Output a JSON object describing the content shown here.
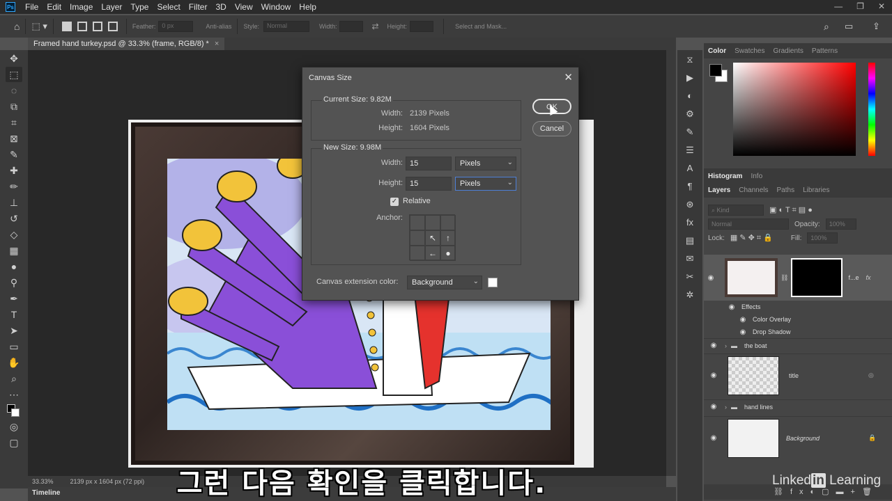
{
  "menubar": {
    "logo": "Ps",
    "items": [
      "File",
      "Edit",
      "Image",
      "Layer",
      "Type",
      "Select",
      "Filter",
      "3D",
      "View",
      "Window",
      "Help"
    ]
  },
  "options": {
    "feather_label": "Feather:",
    "feather_value": "0 px",
    "antialias": "Anti-alias",
    "style_label": "Style:",
    "style_value": "Normal",
    "width_label": "Width:",
    "height_label": "Height:",
    "select_mask": "Select and Mask..."
  },
  "document": {
    "tab_title": "Framed hand turkey.psd @ 33.3% (frame, RGB/8) *"
  },
  "dialog": {
    "title": "Canvas Size",
    "current_size_label": "Current Size: 9.82M",
    "current_width_label": "Width:",
    "current_width_value": "2139 Pixels",
    "current_height_label": "Height:",
    "current_height_value": "1604 Pixels",
    "new_size_label": "New Size: 9.98M",
    "new_width_label": "Width:",
    "new_width_value": "15",
    "new_width_unit": "Pixels",
    "new_height_label": "Height:",
    "new_height_value": "15",
    "new_height_unit": "Pixels",
    "relative_label": "Relative",
    "relative_checked": true,
    "anchor_label": "Anchor:",
    "anchor_cells": [
      "",
      "",
      "",
      "",
      "↖",
      "↑",
      "",
      "←",
      "●"
    ],
    "ext_color_label": "Canvas extension color:",
    "ext_color_value": "Background",
    "ok_label": "OK",
    "cancel_label": "Cancel"
  },
  "panels": {
    "color_tabs": [
      "Color",
      "Swatches",
      "Gradients",
      "Patterns"
    ],
    "hist_tabs": [
      "Histogram",
      "Info"
    ],
    "layer_tabs": [
      "Layers",
      "Channels",
      "Paths",
      "Libraries"
    ],
    "kind_label": "Kind",
    "blend_mode": "Normal",
    "opacity_label": "Opacity:",
    "opacity_value": "100%",
    "lock_label": "Lock:",
    "fill_label": "Fill:",
    "fill_value": "100%",
    "layers": {
      "frame_name": "f...e",
      "effects": "Effects",
      "color_overlay": "Color Overlay",
      "drop_shadow": "Drop Shadow",
      "boat": "the boat",
      "title": "title",
      "hand_lines": "hand lines",
      "background": "Background"
    }
  },
  "status": {
    "zoom": "33.33%",
    "dims": "2139 px x 1604 px (72 ppi)"
  },
  "timeline_label": "Timeline",
  "subtitle": "그런 다음 확인을 클릭합니다.",
  "watermark": {
    "a": "Linked",
    "b": "in",
    "c": " Learning"
  }
}
